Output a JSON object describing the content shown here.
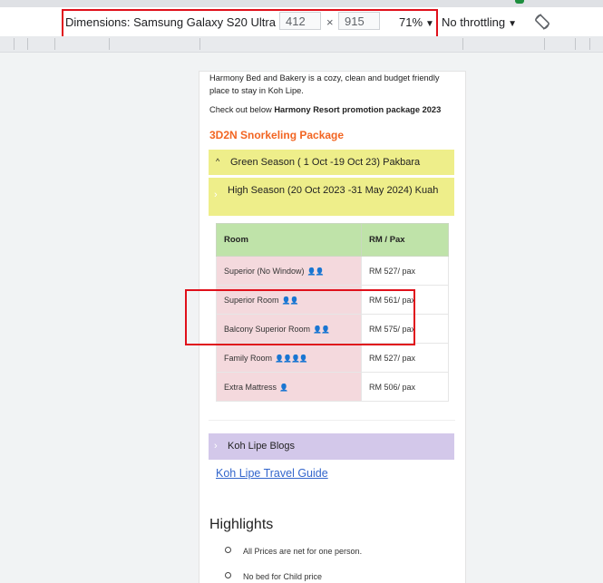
{
  "devtools": {
    "device_label": "Dimensions: Samsung Galaxy S20 Ultra",
    "width": "412",
    "height": "915",
    "times": "×",
    "zoom": "71%",
    "throttling": "No throttling"
  },
  "page": {
    "intro": "Harmony Bed and Bakery is a cozy, clean and budget friendly place to stay in Koh Lipe.",
    "checkout_prefix": "Check out below ",
    "checkout_bold": "Harmony Resort promotion package 2023",
    "package_title": "3D2N Snorkeling Package",
    "green_season": "Green Season ( 1 Oct -19 Oct 23) Pakbara",
    "high_season": "High Season (20 Oct 2023 -31 May 2024) Kuah",
    "table": {
      "headers": [
        "Room",
        "RM / Pax"
      ],
      "rows": [
        {
          "room": "Superior (No Window)",
          "pax": "👤👤",
          "price": "RM 527/ pax"
        },
        {
          "room": "Superior Room",
          "pax": "👤👤",
          "price": "RM 561/ pax"
        },
        {
          "room": "Balcony Superior Room",
          "pax": "👤👤",
          "price": "RM 575/ pax"
        },
        {
          "room": "Family Room",
          "pax": "👤👤👤👤",
          "price": "RM 527/ pax"
        },
        {
          "room": "Extra Mattress",
          "pax": "👤",
          "price": "RM 506/ pax"
        }
      ]
    },
    "blogs_label": "Koh Lipe Blogs",
    "guide_link": "Koh Lipe Travel Guide",
    "highlights_title": "Highlights",
    "highlights": [
      "All Prices are net for one person.",
      "No bed for Child price"
    ]
  },
  "colors": {
    "accent_orange": "#f26522",
    "season_yellow": "#eeee8a",
    "header_green": "#bfe3a9",
    "room_pink": "#f4d9dd",
    "blogs_purple": "#d3c8ea",
    "highlight_red": "#e0101b"
  }
}
